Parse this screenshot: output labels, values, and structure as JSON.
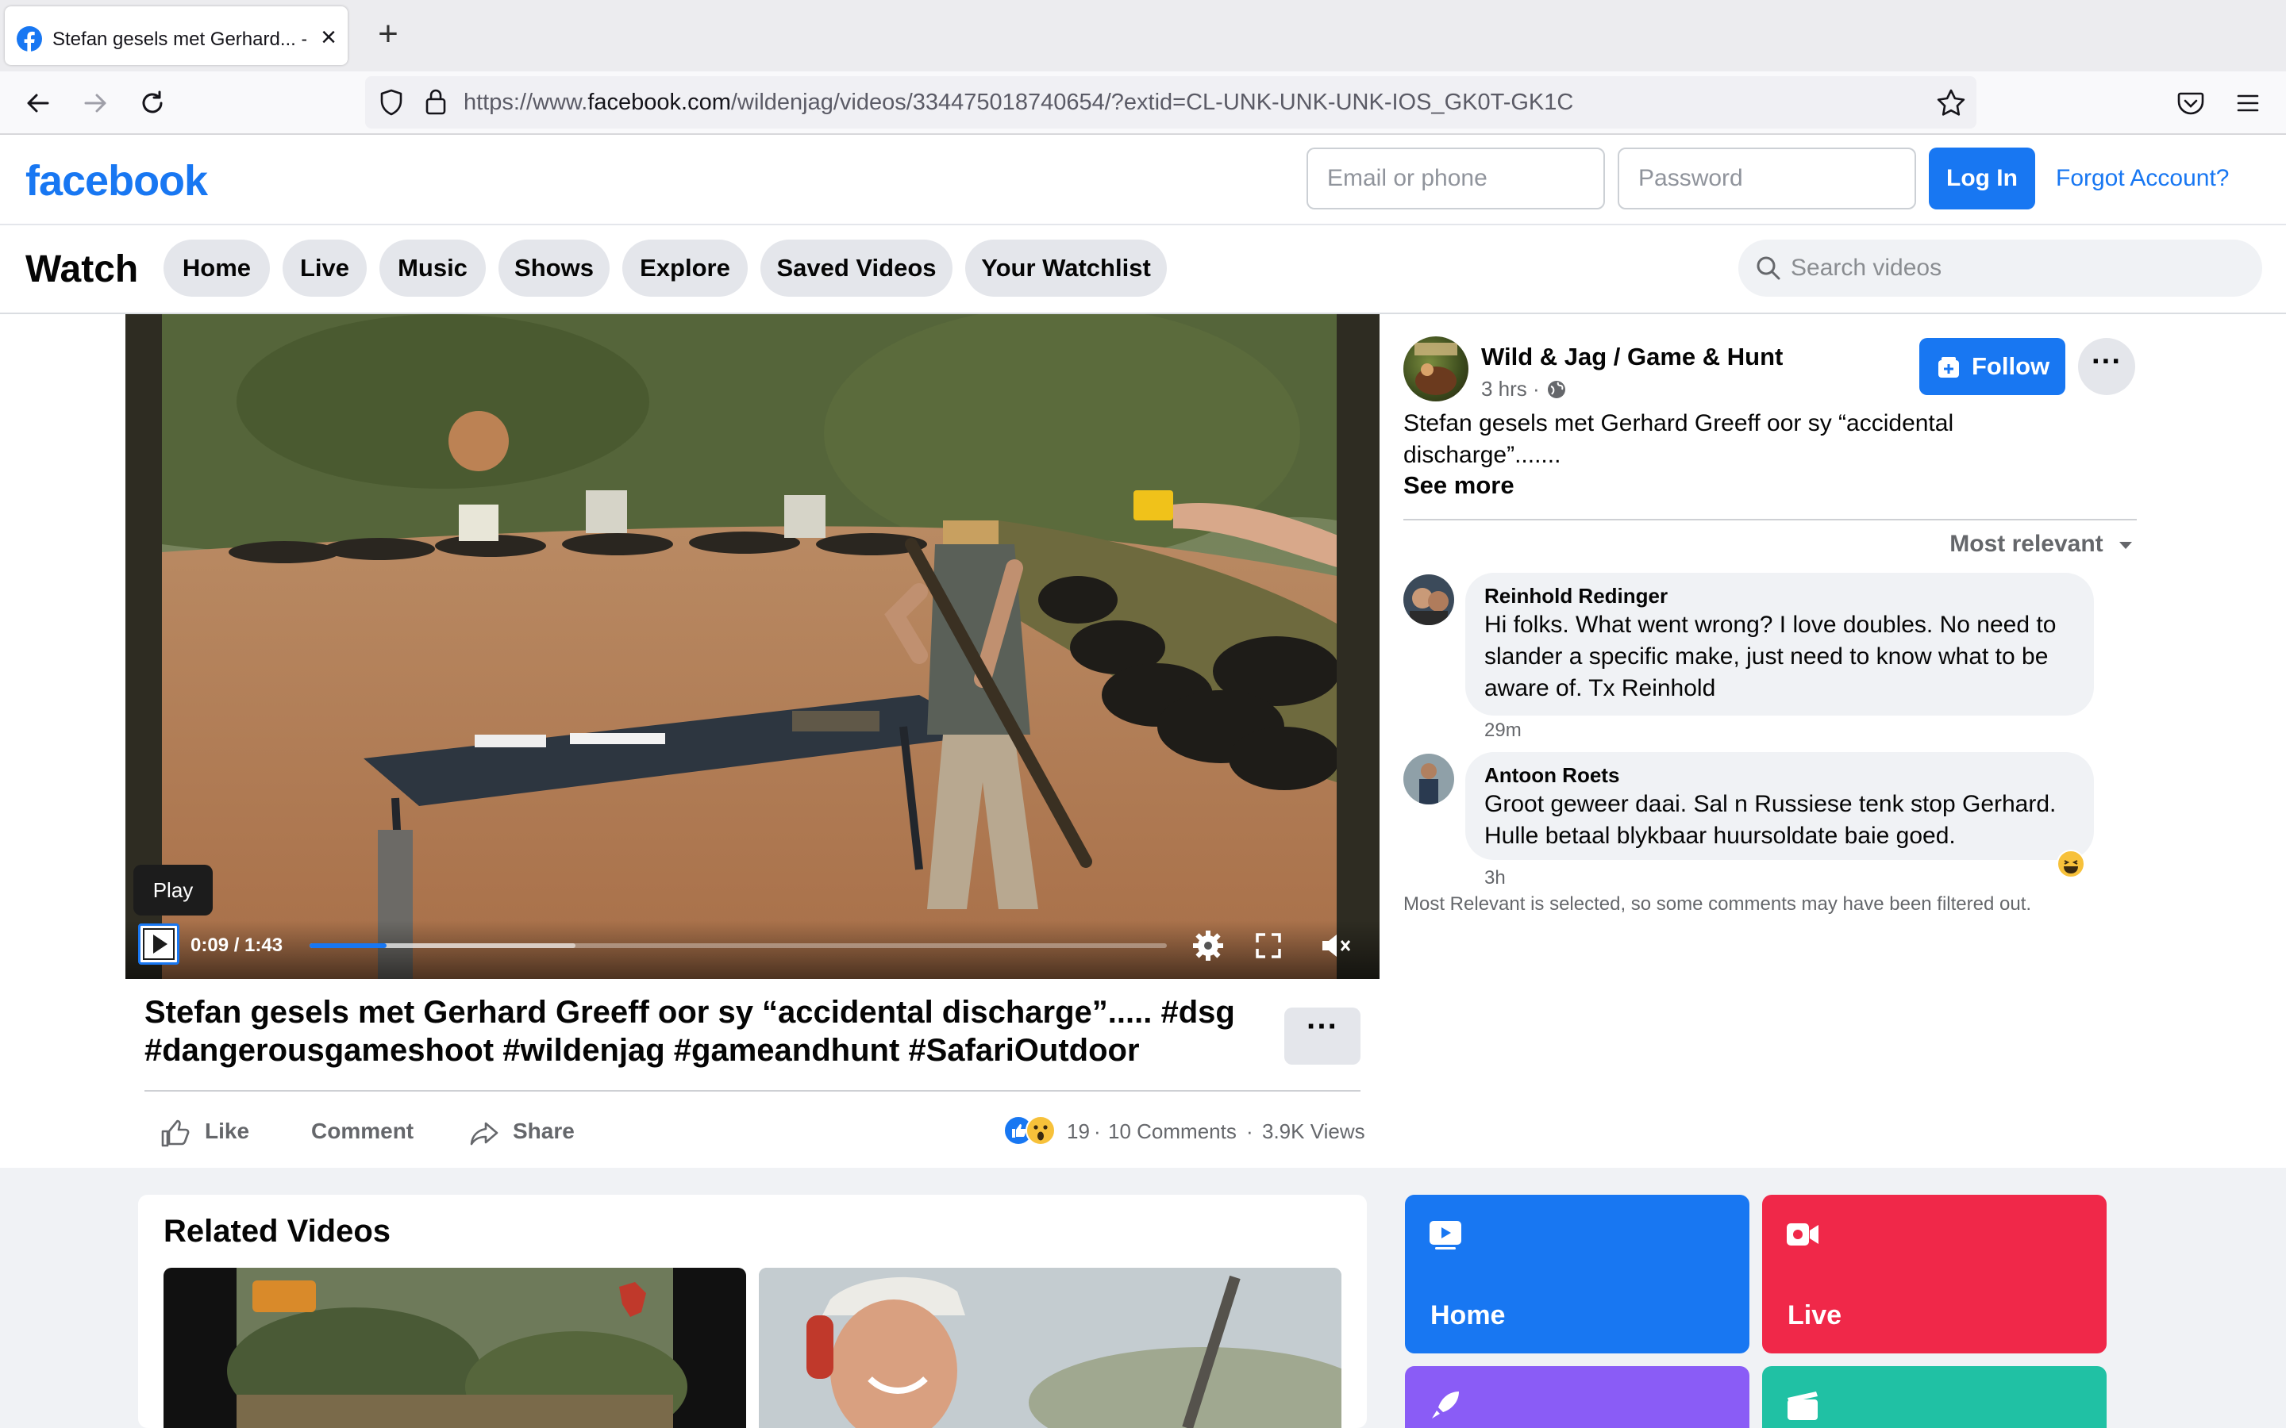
{
  "browser": {
    "tab_title": "Stefan gesels met Gerhard... - W",
    "url_prefix": "https://www.",
    "url_domain": "facebook.com",
    "url_path": "/wildenjag/videos/334475018740654/?extid=CL-UNK-UNK-UNK-IOS_GK0T-GK1C"
  },
  "header": {
    "logo": "facebook",
    "email_placeholder": "Email or phone",
    "password_placeholder": "Password",
    "login_label": "Log In",
    "forgot_label": "Forgot Account?"
  },
  "watch_nav": {
    "title": "Watch",
    "items": [
      "Home",
      "Live",
      "Music",
      "Shows",
      "Explore",
      "Saved Videos",
      "Your Watchlist"
    ],
    "search_placeholder": "Search videos"
  },
  "player": {
    "tooltip": "Play",
    "current_time": "0:09",
    "duration": "1:43",
    "time_display": "0:09 / 1:43",
    "played_fraction": 0.09,
    "buffered_fraction": 0.31
  },
  "video": {
    "title": "Stefan gesels met Gerhard Greeff oor sy “accidental discharge”..... #dsg #dangerousgameshoot #wildenjag #gameandhunt #SafariOutdoor",
    "more_label": "···",
    "actions": {
      "like": "Like",
      "comment": "Comment",
      "share": "Share"
    },
    "reaction_count": "19",
    "comments_count": "10 Comments",
    "views_count": "3.9K Views",
    "separator": "·"
  },
  "post": {
    "page_name": "Wild & Jag / Game & Hunt",
    "time": "3 hrs ·",
    "follow_label": "Follow",
    "more_label": "···",
    "text": "Stefan gesels met Gerhard Greeff oor sy “accidental discharge”.......",
    "see_more": "See more",
    "sort_label": "Most relevant"
  },
  "comments": [
    {
      "name": "Reinhold Redinger",
      "text": "Hi folks. What went wrong? I love doubles. No need to slander a specific make, just need to know what to be aware of. Tx Reinhold",
      "time": "29m"
    },
    {
      "name": "Antoon Roets",
      "text": "Groot geweer daai. Sal n Russiese tenk stop Gerhard. Hulle betaal blykbaar huursoldate baie goed.",
      "time": "3h"
    }
  ],
  "filter_note": "Most Relevant is selected, so some comments may have been filtered out.",
  "related": {
    "title": "Related Videos"
  },
  "tiles": [
    {
      "label": "Home",
      "color": "#1877f2"
    },
    {
      "label": "Live",
      "color": "#f02849"
    },
    {
      "label": "",
      "color": "#8a5cf6"
    },
    {
      "label": "",
      "color": "#20c1a4"
    }
  ]
}
